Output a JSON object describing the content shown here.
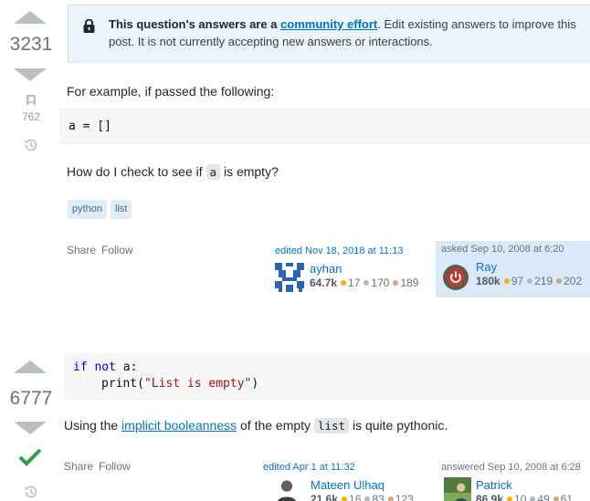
{
  "question": {
    "score": "3231",
    "bookmark_count": "762",
    "notice": {
      "bold": "This question's answers are a ",
      "link": "community effort",
      "rest": ". Edit existing answers to improve this post. It is not currently accepting new answers or interactions."
    },
    "body": {
      "intro": "For example, if passed the following:",
      "code": "a = []",
      "question_pre": "How do I check to see if ",
      "question_code": "a",
      "question_post": " is empty?"
    },
    "tags": [
      "python",
      "list"
    ],
    "menu": {
      "share": "Share",
      "follow": "Follow"
    },
    "editor": {
      "action": "edited Nov 18, 2018 at 11:13",
      "name": "ayhan",
      "rep": "64.7k",
      "gold": "17",
      "silver": "170",
      "bronze": "189"
    },
    "asker": {
      "action": "asked Sep 10, 2008 at 6:20",
      "name": "Ray",
      "rep": "180k",
      "gold": "97",
      "silver": "219",
      "bronze": "202"
    }
  },
  "answer": {
    "score": "6777",
    "code_line1_kw": "if not",
    "code_line1_rest": " a:",
    "code_line2_fn": "print(",
    "code_line2_str": "\"List is empty\"",
    "code_line2_end": ")",
    "text_pre": "Using the ",
    "text_link": "implicit booleanness",
    "text_mid": " of the empty ",
    "text_code": "list",
    "text_post": " is quite pythonic.",
    "menu": {
      "share": "Share",
      "follow": "Follow"
    },
    "editor": {
      "action": "edited Apr 1 at 11:32",
      "name": "Mateen Ulhaq",
      "rep": "21.6k",
      "gold": "16",
      "silver": "83",
      "bronze": "123"
    },
    "author": {
      "action": "answered Sep 10, 2008 at 6:28",
      "name": "Patrick",
      "rep": "86.9k",
      "gold": "10",
      "silver": "49",
      "bronze": "61"
    }
  },
  "colors": {
    "accent": "#0074cc",
    "accepted": "#2f9e44",
    "notice_bg": "#ebf4fb",
    "tag_bg": "#e1ecf4"
  }
}
